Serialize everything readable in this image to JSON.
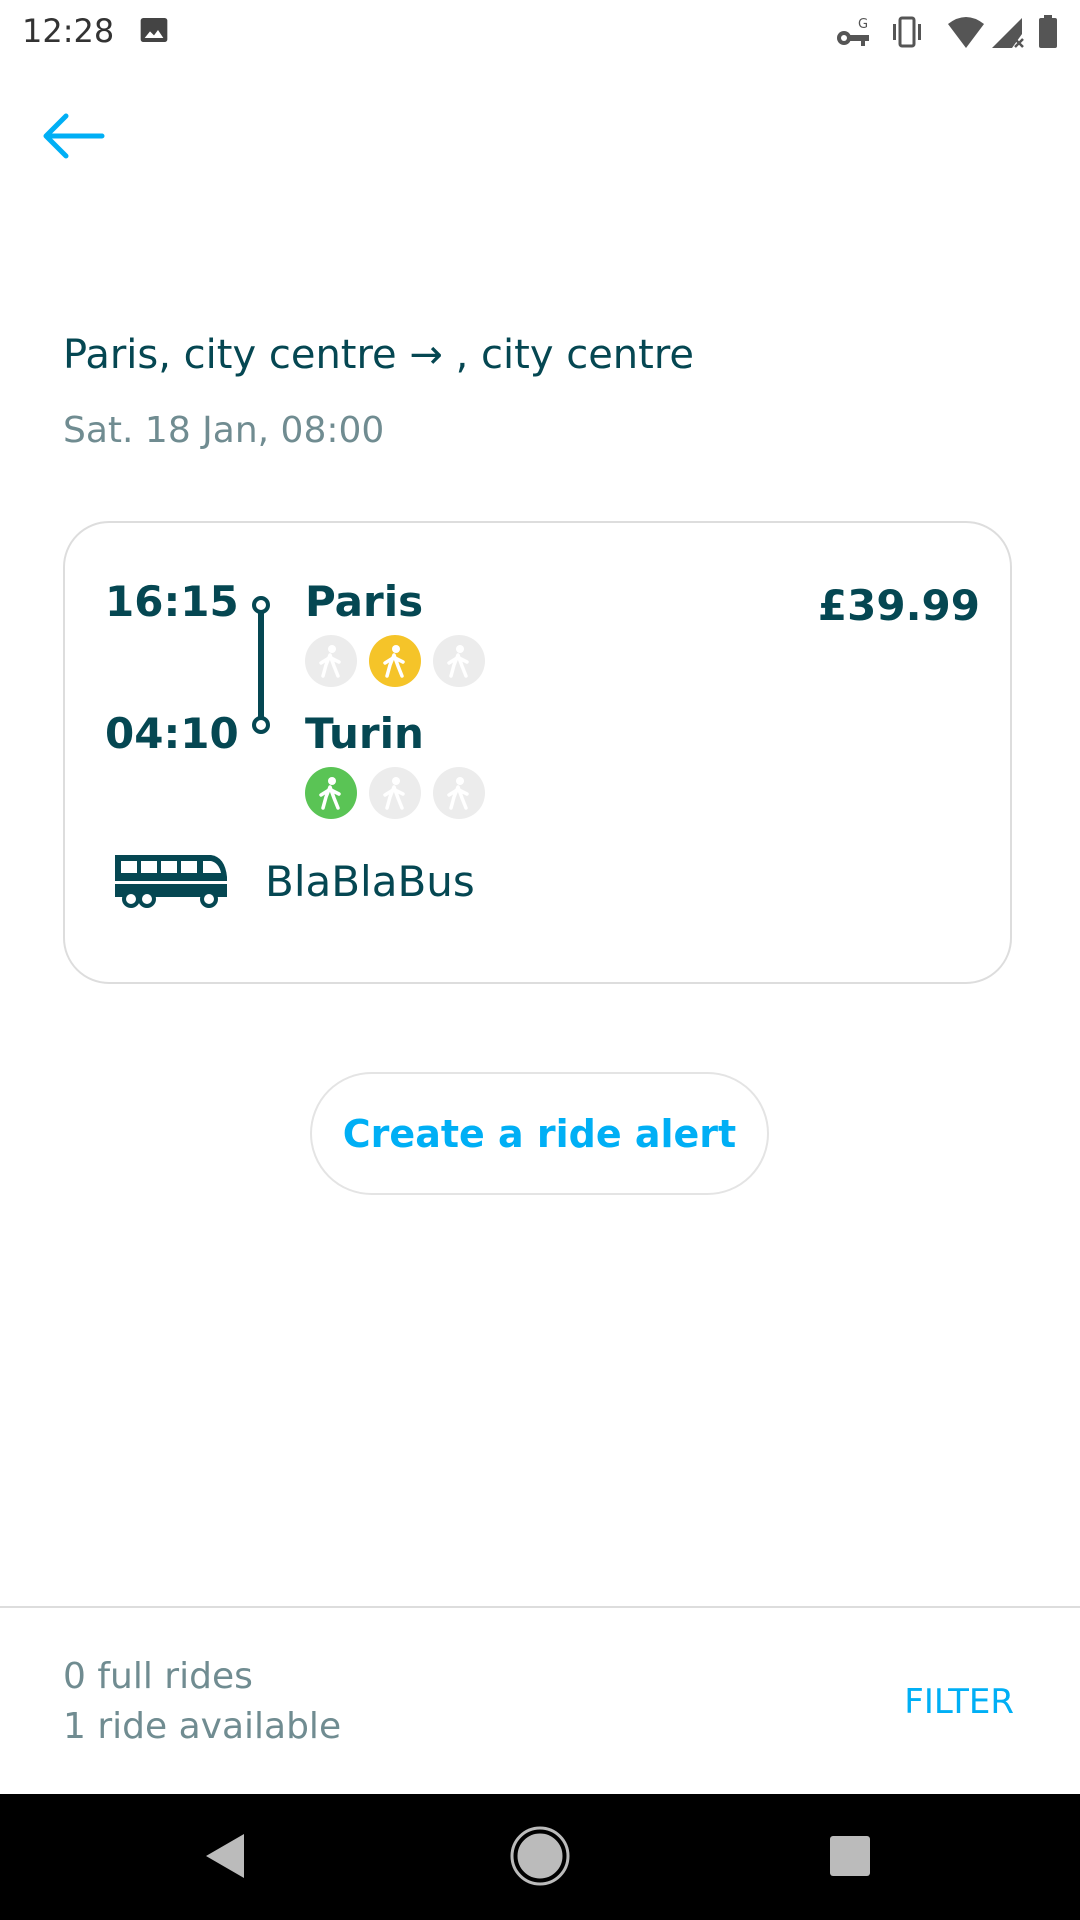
{
  "status_bar": {
    "time": "12:28",
    "icons": [
      "image-icon",
      "vpn-key-icon",
      "vibrate-icon",
      "wifi-icon",
      "cell-signal-icon",
      "battery-icon"
    ]
  },
  "header": {
    "back_icon": "arrow-left-icon",
    "route": "Paris, city centre → , city centre",
    "date": "Sat. 18 Jan, 08:00"
  },
  "ride": {
    "departure_time": "16:15",
    "arrival_time": "04:10",
    "departure_city": "Paris",
    "arrival_city": "Turin",
    "price": "£39.99",
    "operator": "BlaBlaBus",
    "departure_proximity": [
      "none",
      "yellow",
      "none"
    ],
    "arrival_proximity": [
      "green",
      "none",
      "none"
    ]
  },
  "alert_button": {
    "label": "Create a ride alert"
  },
  "summary": {
    "full_rides": "0 full rides",
    "available": "1 ride available",
    "filter_label": "FILTER"
  },
  "colors": {
    "primary": "#054752",
    "accent": "#00aff5",
    "muted": "#708c91",
    "proximity_yellow": "#f5c429",
    "proximity_green": "#5ac455"
  }
}
